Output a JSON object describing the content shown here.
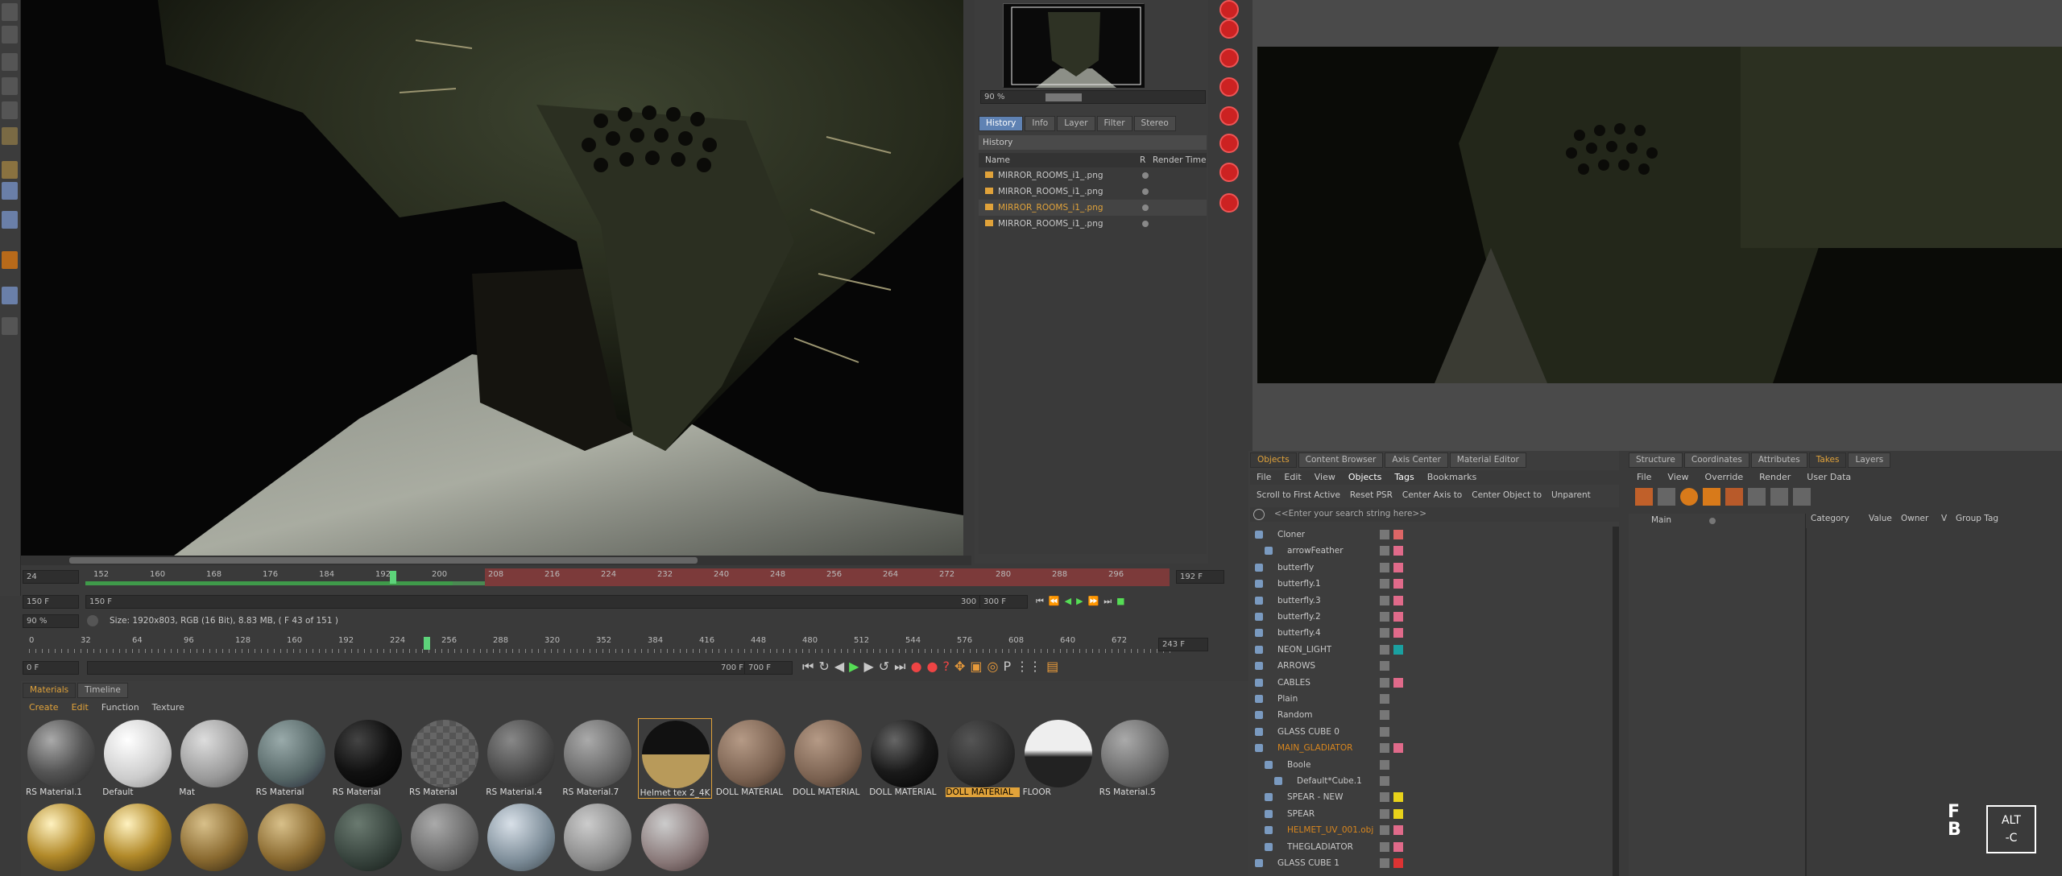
{
  "timeline": {
    "current_frame": "24",
    "ruler_top": [
      "152",
      "160",
      "168",
      "176",
      "184",
      "192",
      "200",
      "208",
      "216",
      "224",
      "232",
      "240",
      "248",
      "256",
      "264",
      "272",
      "280",
      "288",
      "296"
    ],
    "end_field_top": "192 F",
    "start_field": "150 F",
    "mid_field": "150 F",
    "end_field": "300 F",
    "end_field2": "300 F",
    "zoom_field": "90 %",
    "image_info": "Size: 1920x803, RGB (16 Bit), 8.83 MB,  ( F 43 of 151 )",
    "ruler_bottom": [
      "0",
      "32",
      "64",
      "96",
      "128",
      "160",
      "192",
      "224",
      "256",
      "288",
      "320",
      "352",
      "384",
      "416",
      "448",
      "480",
      "512",
      "544",
      "576",
      "608",
      "640",
      "672"
    ],
    "ruler_bottom_end": "243 F",
    "bottom_start": "0 F",
    "bottom_mid": "700 F",
    "bottom_end": "700 F",
    "playhead_label": "24"
  },
  "picture_viewer": {
    "zoom": "90 %",
    "tabs": [
      "History",
      "Info",
      "Layer",
      "Filter",
      "Stereo"
    ],
    "section": "History",
    "columns": {
      "name": "Name",
      "r": "R",
      "render_time": "Render Time"
    },
    "rows": [
      {
        "name": "MIRROR_ROOMS_i1_.png",
        "active": false
      },
      {
        "name": "MIRROR_ROOMS_i1_.png",
        "active": false
      },
      {
        "name": "MIRROR_ROOMS_i1_.png",
        "active": true
      },
      {
        "name": "MIRROR_ROOMS_i1_.png",
        "active": false
      }
    ]
  },
  "object_manager": {
    "tabs": [
      "Objects",
      "Content Browser",
      "Axis Center",
      "Material Editor"
    ],
    "menu": [
      "File",
      "Edit",
      "View",
      "Objects",
      "Tags",
      "Bookmarks"
    ],
    "toolbar": [
      "Scroll to First Active",
      "Reset PSR",
      "Center Axis to",
      "Center Object to",
      "Unparent"
    ],
    "search_placeholder": "<<Enter your search string here>>",
    "objects": [
      {
        "name": "Cloner",
        "indent": 0,
        "color": "#d66",
        "highlight": false
      },
      {
        "name": "arrowFeather",
        "indent": 1,
        "color": "#e06a8a",
        "highlight": false
      },
      {
        "name": "butterfly",
        "indent": 0,
        "color": "#e06a8a",
        "highlight": false
      },
      {
        "name": "butterfly.1",
        "indent": 0,
        "color": "#e06a8a",
        "highlight": false
      },
      {
        "name": "butterfly.3",
        "indent": 0,
        "color": "#e06a8a",
        "highlight": false
      },
      {
        "name": "butterfly.2",
        "indent": 0,
        "color": "#e06a8a",
        "highlight": false
      },
      {
        "name": "butterfly.4",
        "indent": 0,
        "color": "#e06a8a",
        "highlight": false
      },
      {
        "name": "NEON_LIGHT",
        "indent": 0,
        "color": "#1aa0a0",
        "highlight": false
      },
      {
        "name": "ARROWS",
        "indent": 0,
        "color": "",
        "highlight": false
      },
      {
        "name": "CABLES",
        "indent": 0,
        "color": "#e06a8a",
        "highlight": false
      },
      {
        "name": "Plain",
        "indent": 0,
        "color": "",
        "highlight": false
      },
      {
        "name": "Random",
        "indent": 0,
        "color": "",
        "highlight": false
      },
      {
        "name": "GLASS CUBE 0",
        "indent": 0,
        "color": "",
        "highlight": false
      },
      {
        "name": "MAIN_GLADIATOR",
        "indent": 0,
        "color": "#e06a8a",
        "highlight": true
      },
      {
        "name": "Boole",
        "indent": 1,
        "color": "",
        "highlight": false
      },
      {
        "name": "Default*Cube.1",
        "indent": 2,
        "color": "",
        "highlight": false
      },
      {
        "name": "SPEAR - NEW",
        "indent": 1,
        "color": "#e8d21a",
        "highlight": false
      },
      {
        "name": "SPEAR",
        "indent": 1,
        "color": "#e8d21a",
        "highlight": false
      },
      {
        "name": "HELMET_UV_001.obj",
        "indent": 1,
        "color": "#e06a8a",
        "highlight": true
      },
      {
        "name": "THEGLADIATOR",
        "indent": 1,
        "color": "#e06a8a",
        "highlight": false
      },
      {
        "name": "GLASS CUBE 1",
        "indent": 0,
        "color": "#d33",
        "highlight": false
      }
    ]
  },
  "takes": {
    "tabs": [
      "Structure",
      "Coordinates",
      "Attributes",
      "Takes",
      "Layers"
    ],
    "menu": [
      "File",
      "View",
      "Override",
      "Render",
      "User Data"
    ],
    "root": "Main",
    "columns": [
      "Category",
      "Value",
      "Owner",
      "V",
      "Group Tag"
    ]
  },
  "materials": {
    "tabs": [
      "Materials",
      "Timeline"
    ],
    "menu": [
      "Create",
      "Edit",
      "Function",
      "Texture"
    ],
    "row1": [
      {
        "label": "RS Material.1",
        "style": "chrome-dark"
      },
      {
        "label": "Default",
        "style": "white"
      },
      {
        "label": "Mat",
        "style": "marble"
      },
      {
        "label": "RS Material",
        "style": "marble-dark"
      },
      {
        "label": "RS Material",
        "style": "black"
      },
      {
        "label": "RS Material",
        "style": "checker"
      },
      {
        "label": "RS Material.4",
        "style": "grey-dark"
      },
      {
        "label": "RS Material.7",
        "style": "grey"
      },
      {
        "label": "Helmet tex 2_4K",
        "style": "gold-half"
      },
      {
        "label": "DOLL MATERIAL",
        "style": "skin"
      },
      {
        "label": "DOLL MATERIAL",
        "style": "skin"
      },
      {
        "label": "DOLL MATERIAL",
        "style": "black-gloss"
      },
      {
        "label": "DOLL MATERIAL",
        "style": "dark-rough"
      },
      {
        "label": "FLOOR",
        "style": "chrome"
      },
      {
        "label": "RS Material.5",
        "style": "grey"
      }
    ],
    "row2": [
      {
        "style": "gold"
      },
      {
        "style": "gold"
      },
      {
        "style": "gold-rough"
      },
      {
        "style": "gold-rough"
      },
      {
        "style": "teal-rough"
      },
      {
        "style": "grey"
      },
      {
        "style": "glass"
      },
      {
        "style": "grey-light"
      },
      {
        "style": "stone"
      }
    ]
  },
  "watermark": {
    "logo_text": "ALT\n-C"
  }
}
